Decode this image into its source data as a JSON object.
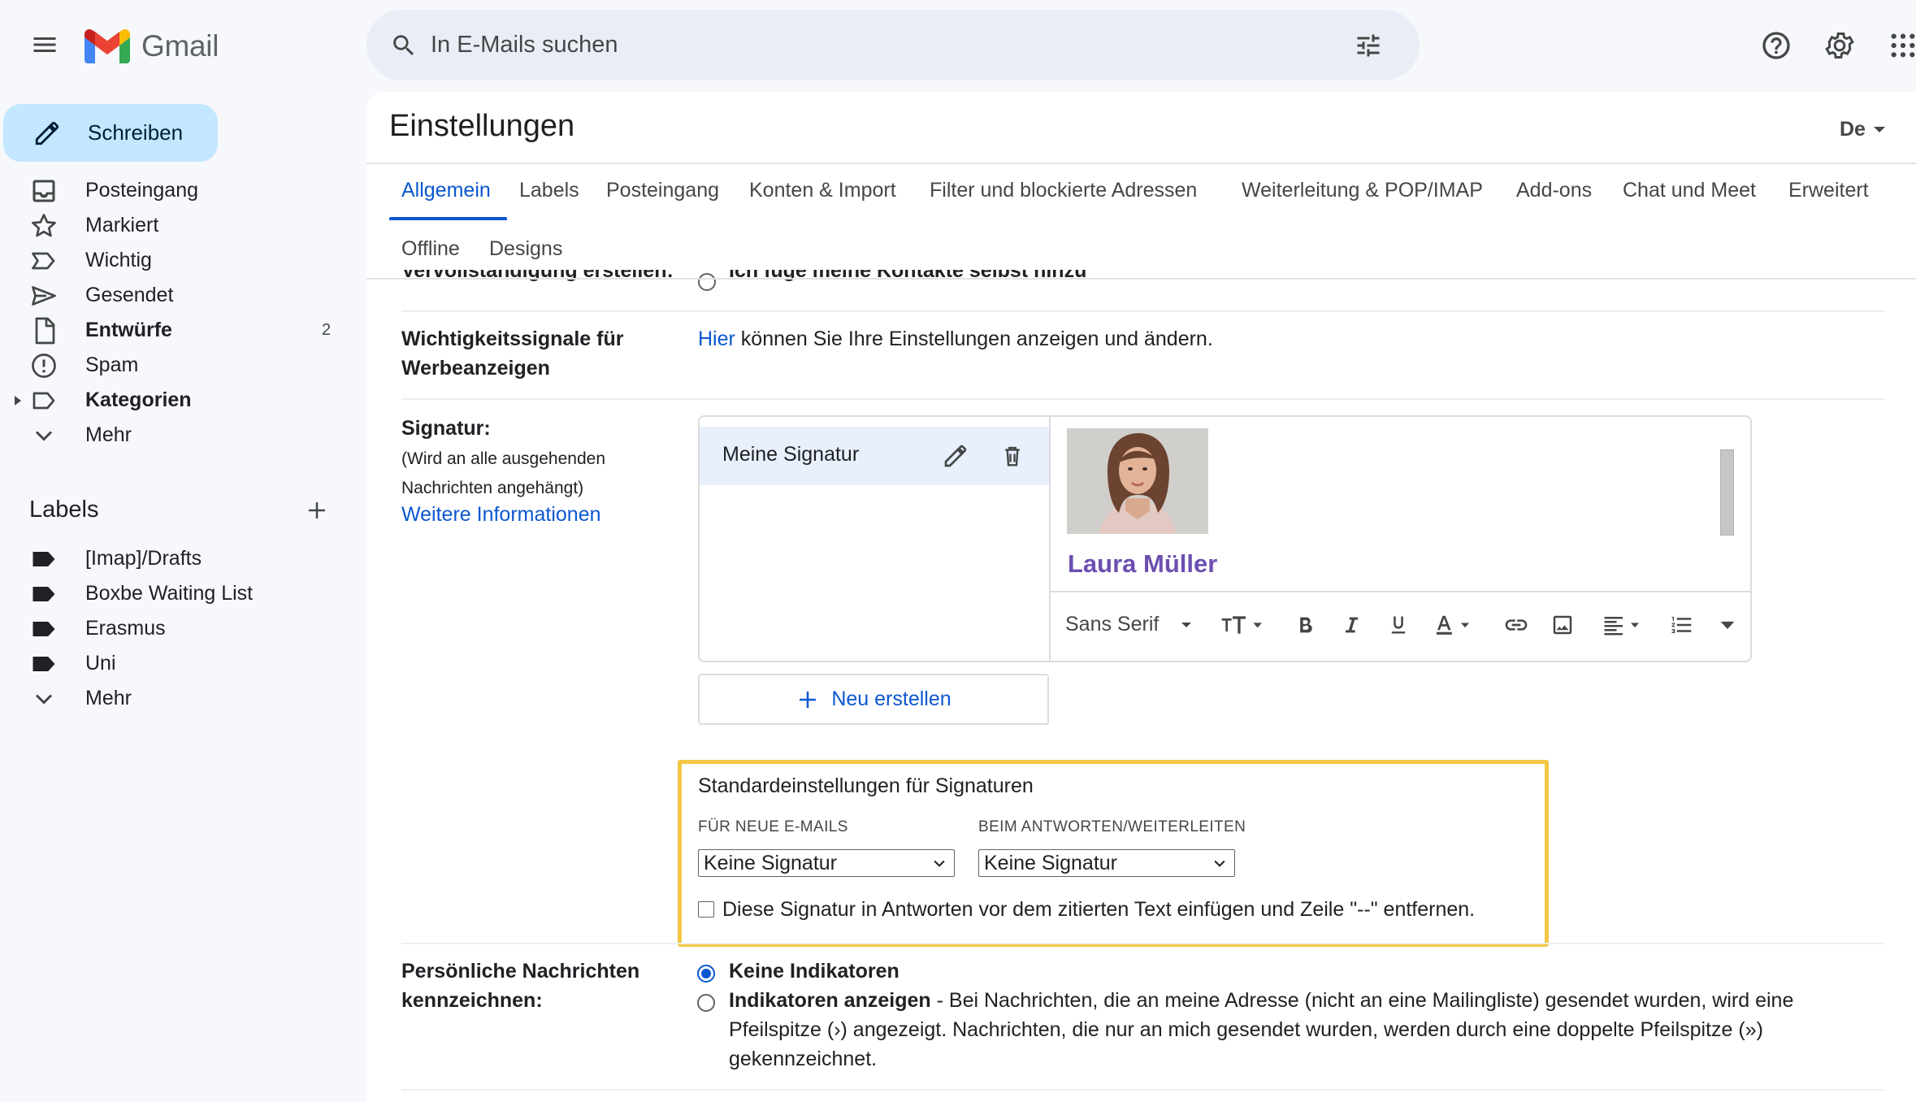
{
  "app": {
    "name": "Gmail",
    "brand_colors": {
      "red": "#ea4335",
      "blue": "#4285f4",
      "green": "#34a853",
      "yellow": "#fbbc04"
    }
  },
  "header": {
    "search_placeholder": "In E-Mails suchen",
    "icons": [
      "menu-icon",
      "search-icon",
      "filter-options-icon",
      "help-icon",
      "settings-icon",
      "apps-icon"
    ]
  },
  "sidebar": {
    "compose_label": "Schreiben",
    "items": [
      {
        "label": "Posteingang",
        "icon": "inbox-icon",
        "count": "",
        "bold": false
      },
      {
        "label": "Markiert",
        "icon": "star-icon",
        "count": "",
        "bold": false
      },
      {
        "label": "Wichtig",
        "icon": "important-icon",
        "count": "",
        "bold": false
      },
      {
        "label": "Gesendet",
        "icon": "send-icon",
        "count": "",
        "bold": false
      },
      {
        "label": "Entwürfe",
        "icon": "draft-icon",
        "count": "2",
        "bold": true
      },
      {
        "label": "Spam",
        "icon": "spam-icon",
        "count": "",
        "bold": false
      },
      {
        "label": "Kategorien",
        "icon": "label-outline-icon",
        "count": "",
        "bold": true
      },
      {
        "label": "Mehr",
        "icon": "chevron-down-icon",
        "count": "",
        "bold": false
      }
    ],
    "labels_title": "Labels",
    "labels": [
      {
        "label": "[Imap]/Drafts"
      },
      {
        "label": "Boxbe Waiting List"
      },
      {
        "label": "Erasmus"
      },
      {
        "label": "Uni"
      }
    ],
    "labels_more": "Mehr"
  },
  "settings": {
    "title": "Einstellungen",
    "language_toggle": "De",
    "tabs": [
      {
        "label": "Allgemein",
        "active": true
      },
      {
        "label": "Labels",
        "active": false
      },
      {
        "label": "Posteingang",
        "active": false
      },
      {
        "label": "Konten & Import",
        "active": false
      },
      {
        "label": "Filter und blockierte Adressen",
        "active": false
      },
      {
        "label": "Weiterleitung & POP/IMAP",
        "active": false
      },
      {
        "label": "Add-ons",
        "active": false
      },
      {
        "label": "Chat und Meet",
        "active": false
      },
      {
        "label": "Erweitert",
        "active": false
      },
      {
        "label": "Offline",
        "active": false
      },
      {
        "label": "Designs",
        "active": false
      }
    ],
    "cut_row": {
      "label": "Vervollständigung erstellen:",
      "option": "Ich füge meine Kontakte selbst hinzu"
    },
    "ad_signals": {
      "label_line1": "Wichtigkeitssignale für",
      "label_line2": "Werbeanzeigen",
      "link": "Hier",
      "text": " können Sie Ihre Einstellungen anzeigen und ändern."
    },
    "signature": {
      "label": "Signatur:",
      "hint_line1": "(Wird an alle ausgehenden",
      "hint_line2": "Nachrichten angehängt)",
      "more_info": "Weitere Informationen",
      "selected_signature": "Meine Signatur",
      "sender_name": "Laura Müller",
      "font": "Sans Serif",
      "toolbar_icons": [
        "text-size-icon",
        "bold-icon",
        "italic-icon",
        "underline-icon",
        "text-color-icon",
        "link-icon",
        "image-icon",
        "align-icon",
        "numbered-list-icon",
        "more-formatting-icon"
      ],
      "new_button": "Neu erstellen"
    },
    "signature_defaults": {
      "title": "Standardeinstellungen für Signaturen",
      "new_mails_label": "FÜR NEUE E-MAILS",
      "new_mails_value": "Keine Signatur",
      "reply_label": "BEIM ANTWORTEN/WEITERLEITEN",
      "reply_value": "Keine Signatur",
      "insert_checkbox_text": "Diese Signatur in Antworten vor dem zitierten Text einfügen und Zeile \"--\" entfernen.",
      "insert_checked": false,
      "highlight_color": "#f2c744"
    },
    "personal_indicators": {
      "label_line1": "Persönliche Nachrichten",
      "label_line2": "kennzeichnen:",
      "option1": "Keine Indikatoren",
      "option1_checked": true,
      "option2": "Indikatoren anzeigen",
      "option2_desc_line1": " - Bei Nachrichten, die an meine Adresse (nicht an eine Mailingliste) gesendet wurden, wird eine",
      "option2_desc_line2": "Pfeilspitze (›) angezeigt. Nachrichten, die nur an mich gesendet wurden, werden durch eine doppelte Pfeilspitze (»)",
      "option2_desc_line3": "gekennzeichnet."
    }
  }
}
